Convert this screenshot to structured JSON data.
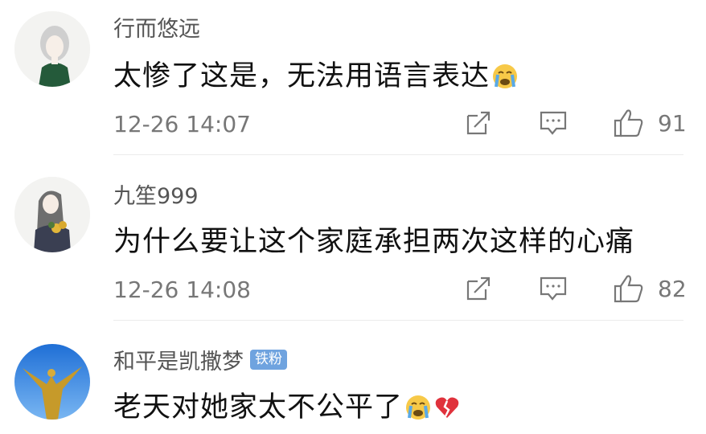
{
  "comments": [
    {
      "username": "行而悠远",
      "badge": "",
      "text": "太惨了这是，无法用语言表达",
      "emojis": [
        "crying-face-emoji"
      ],
      "time": "12-26 14:07",
      "like_count": "91",
      "avatar": "girl-illustration-avatar"
    },
    {
      "username": "九笙999",
      "badge": "",
      "text": "为什么要让这个家庭承担两次这样的心痛",
      "emojis": [],
      "time": "12-26 14:08",
      "like_count": "82",
      "avatar": "girl-with-flowers-avatar"
    },
    {
      "username": "和平是凯撒梦",
      "badge": "铁粉",
      "text": "老天对她家太不公平了",
      "emojis": [
        "crying-face-emoji",
        "broken-heart-emoji"
      ],
      "avatar": "golden-statue-sky-avatar"
    }
  ],
  "colors": {
    "badge": "#6fa3df",
    "text": "#111111",
    "meta": "#777777"
  },
  "icons": [
    "share-icon",
    "comment-icon",
    "like-icon"
  ]
}
